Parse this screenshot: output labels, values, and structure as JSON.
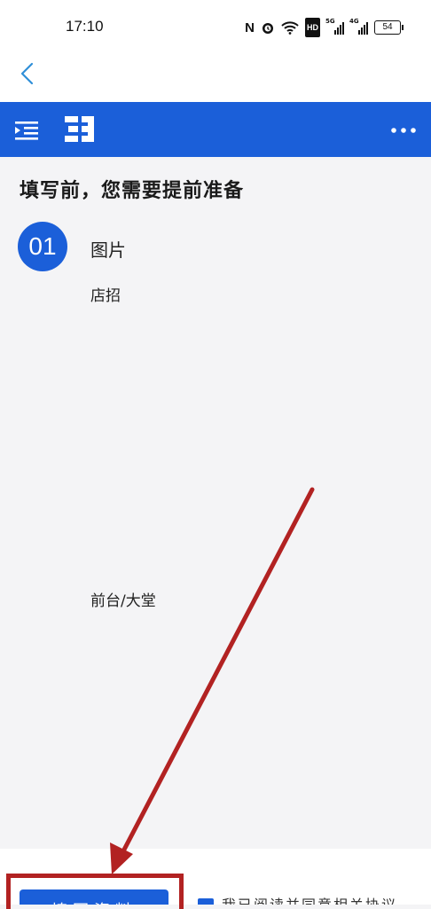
{
  "status_bar": {
    "time": "17:10",
    "icons": [
      "nfc-icon",
      "alarm-icon",
      "wifi-icon",
      "hd-icon",
      "signal-5g-icon",
      "signal-4g-icon"
    ],
    "hd_label": "HD",
    "signal_1_label": "5G",
    "signal_2_label": "4G",
    "battery": "54"
  },
  "nav": {
    "back_icon": "chevron-left-icon"
  },
  "header": {
    "menu_icon": "indent-menu-icon",
    "logo_icon": "brand-logo-icon",
    "more_icon": "more-dots-icon"
  },
  "page": {
    "title": "填写前，您需要提前准备",
    "step_number": "01",
    "section_title": "图片",
    "photo_items": [
      {
        "label": "店招"
      },
      {
        "label": "前台/大堂"
      }
    ]
  },
  "footer": {
    "fill_button_label": "填写资料",
    "agree_text": "我已阅读并同意相关协议"
  },
  "colors": {
    "brand_blue": "#1b5fd9",
    "annotation_red": "#b22222",
    "background": "#f4f4f6"
  }
}
